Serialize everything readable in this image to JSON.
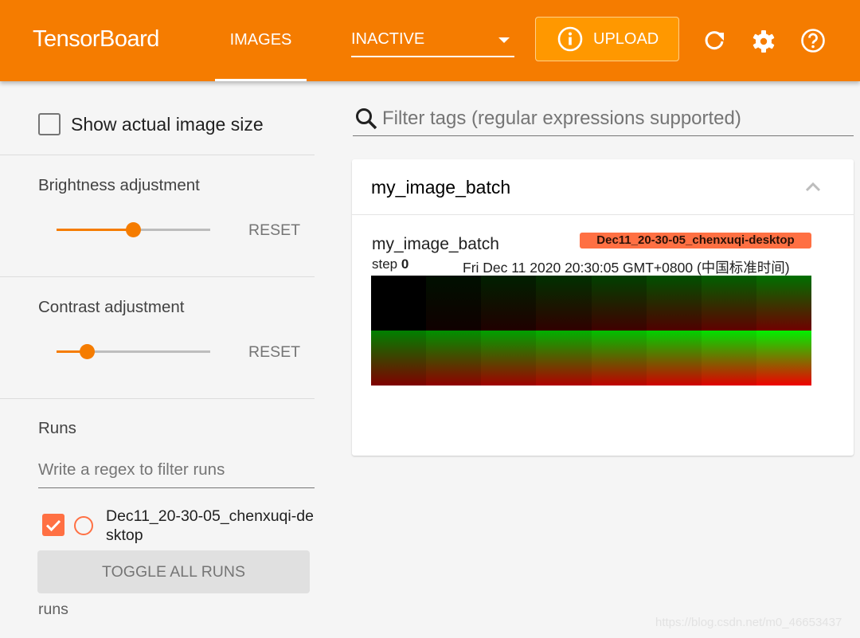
{
  "header": {
    "brand": "TensorBoard",
    "active_tab": "IMAGES",
    "plugin_select": "INACTIVE",
    "upload_label": "UPLOAD",
    "icons": [
      "refresh-icon",
      "gear-icon",
      "help-icon"
    ],
    "accent_color": "#f57c00"
  },
  "sidebar": {
    "show_actual_size": {
      "label": "Show actual image size",
      "checked": false
    },
    "brightness": {
      "title": "Brightness adjustment",
      "value_fraction": 0.5,
      "reset_label": "RESET"
    },
    "contrast": {
      "title": "Contrast adjustment",
      "value_fraction": 0.2,
      "reset_label": "RESET"
    },
    "runs": {
      "title": "Runs",
      "filter_placeholder": "Write a regex to filter runs",
      "items": [
        {
          "name": "Dec11_20-30-05_chenxuqi-desktop",
          "checked": true,
          "color": "#ff7043"
        }
      ],
      "toggle_all_label": "TOGGLE ALL RUNS",
      "footer": "runs"
    }
  },
  "main": {
    "tag_filter_placeholder": "Filter tags (regular expressions supported)",
    "card": {
      "title": "my_image_batch",
      "expanded": true,
      "image": {
        "tag": "my_image_batch",
        "run": "Dec11_20-30-05_chenxuqi-desktop",
        "step_label": "step",
        "step": "0",
        "timestamp": "Fri Dec 11 2020 20:30:05 GMT+0800 (中国标准时间)",
        "grid": {
          "rows": 2,
          "cols": 8,
          "tiles": 16
        }
      }
    }
  },
  "watermark": "https://blog.csdn.net/m0_46653437"
}
